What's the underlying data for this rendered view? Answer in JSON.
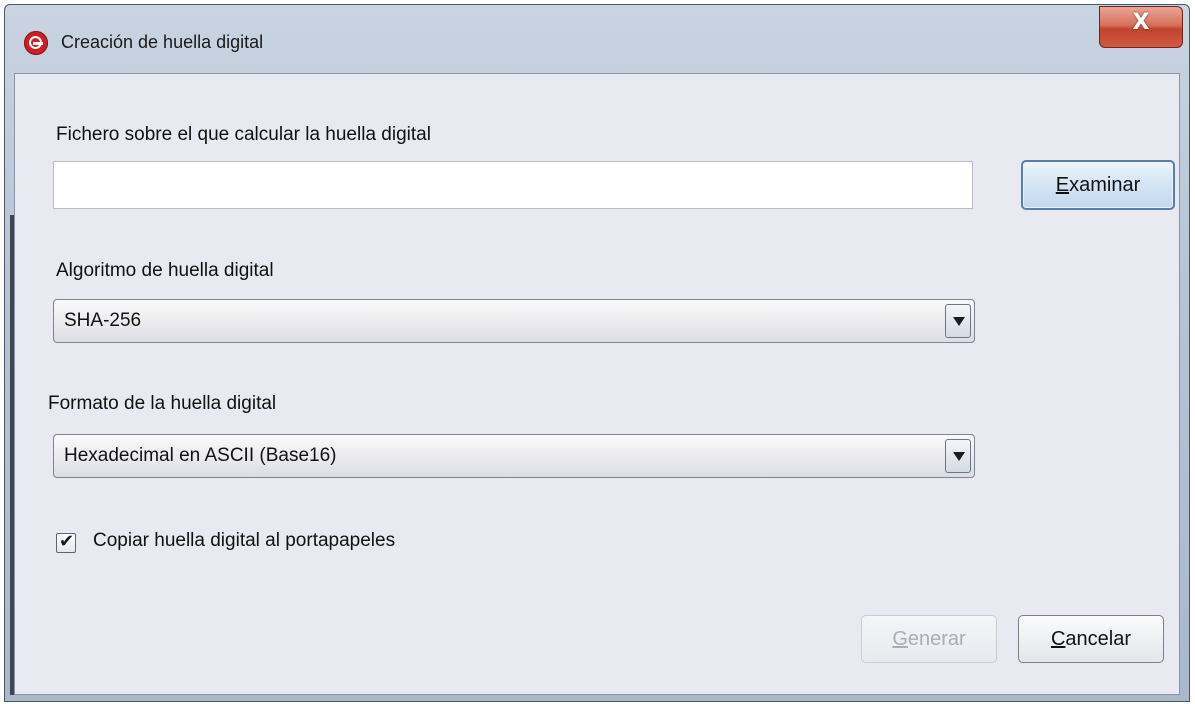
{
  "window": {
    "title": "Creación de huella digital",
    "close_label": "X"
  },
  "file": {
    "label": "Fichero sobre el que calcular la huella digital",
    "value": "",
    "browse_mnemonic": "E",
    "browse_rest": "xaminar"
  },
  "algorithm": {
    "label": "Algoritmo de huella digital",
    "selected": "SHA-256"
  },
  "format": {
    "label": "Formato de la huella digital",
    "selected": "Hexadecimal en ASCII (Base16)"
  },
  "copy_option": {
    "label": "Copiar huella digital al portapapeles",
    "checked": true
  },
  "buttons": {
    "generate_mnemonic": "G",
    "generate_rest": "enerar",
    "generate_enabled": false,
    "cancel_mnemonic": "C",
    "cancel_rest": "ancelar"
  }
}
